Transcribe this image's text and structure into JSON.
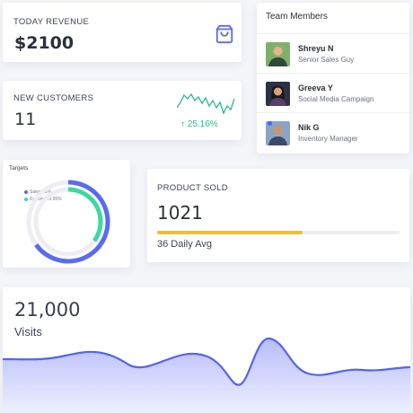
{
  "revenue": {
    "label": "TODAY REVENUE",
    "value": "$2100",
    "icon": "shopping-bag-icon"
  },
  "customers": {
    "label": "NEW CUSTOMERS",
    "value": "11",
    "change": "↑ 25.16%",
    "trend_color": "#29bb89"
  },
  "team": {
    "title": "Team Members",
    "members": [
      {
        "name": "Shreyu N",
        "role": "Senior Sales Guy"
      },
      {
        "name": "Greeva Y",
        "role": "Social Media Campaign"
      },
      {
        "name": "Nik G",
        "role": "Inventory Manager"
      }
    ]
  },
  "targets": {
    "title": "Targets",
    "legend": [
      "Sales 65%",
      "Customers 35%"
    ],
    "chart_data": {
      "type": "pie",
      "series": [
        {
          "name": "Sales",
          "value": 65,
          "color": "#5b6bf0"
        },
        {
          "name": "Customers",
          "value": 35,
          "color": "#3dd9a0"
        }
      ]
    }
  },
  "product": {
    "label": "PRODUCT SOLD",
    "value": "1021",
    "progress": 0.6,
    "avg": "36 Daily Avg",
    "bar_color": "#f4bf20"
  },
  "visits": {
    "value": "21,000",
    "label": "Visits",
    "line_color": "#5664ee"
  }
}
